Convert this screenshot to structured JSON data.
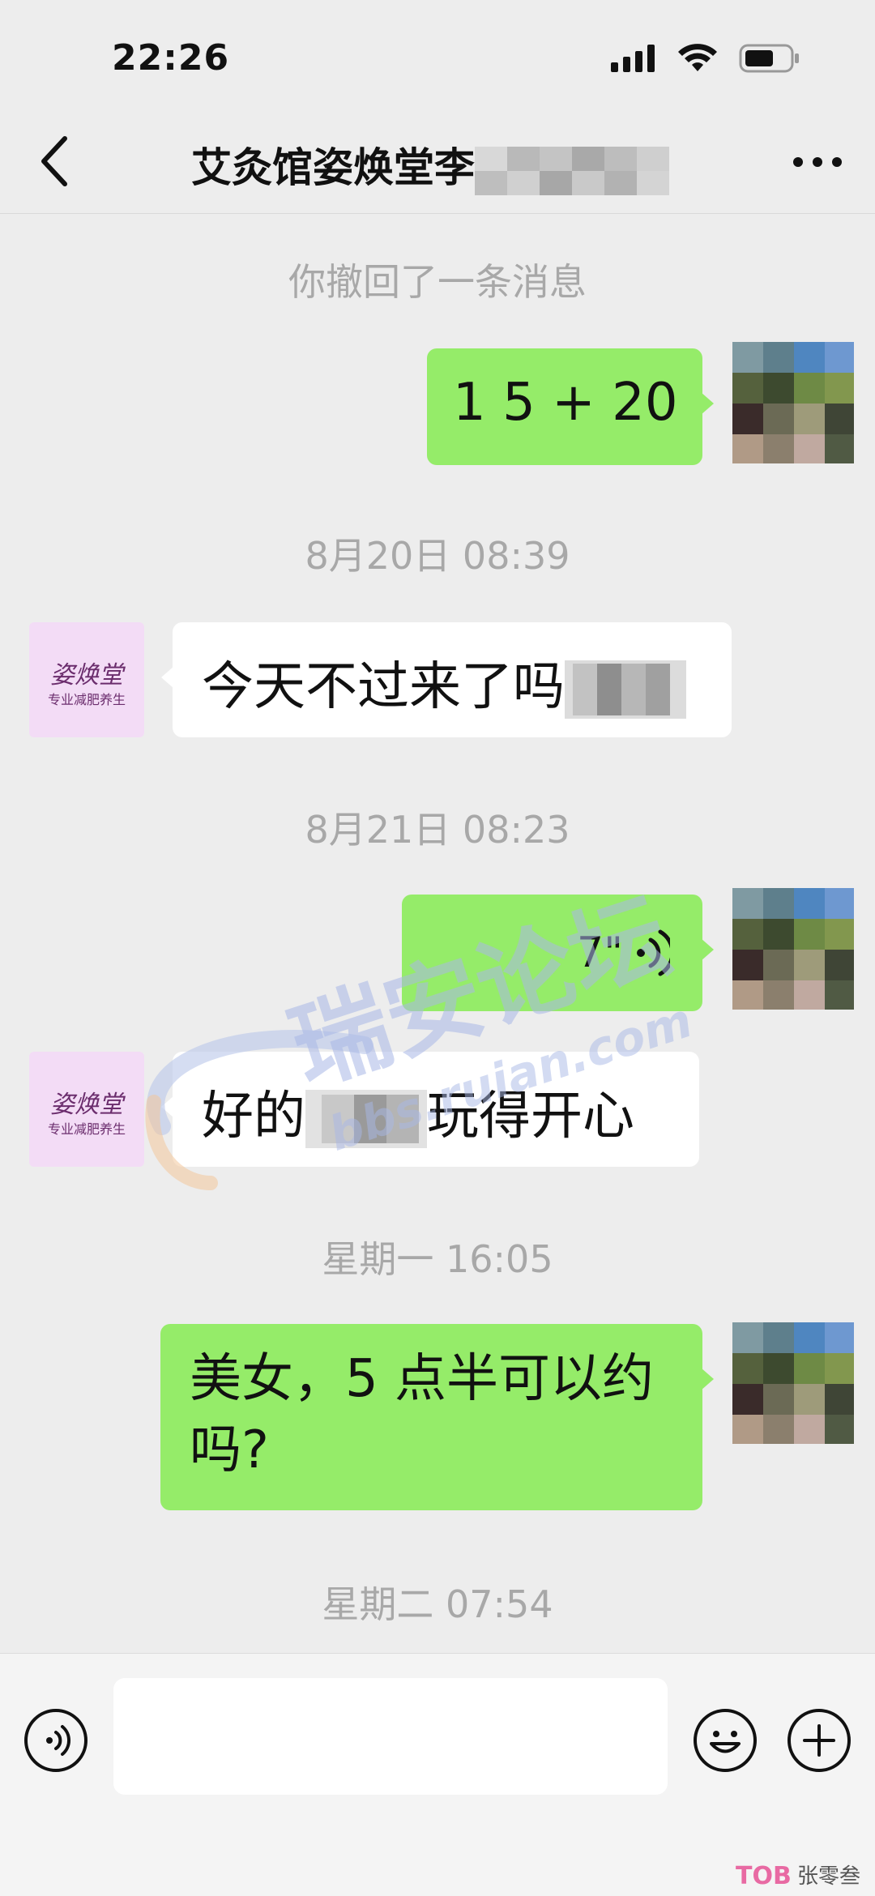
{
  "status_bar": {
    "time": "22:26"
  },
  "header": {
    "title": "艾灸馆姿焕堂李"
  },
  "recall_notice": "你撤回了一条消息",
  "messages": [
    {
      "sender": "me",
      "text": "1 5 + 20"
    },
    {
      "timestamp": "8月20日 08:39"
    },
    {
      "sender": "shop",
      "text": "今天不过来了吗"
    },
    {
      "timestamp": "8月21日 08:23"
    },
    {
      "sender": "me",
      "voice_duration": "7\""
    },
    {
      "sender": "shop",
      "text_a": "好的",
      "text_b": "玩得开心"
    },
    {
      "timestamp": "星期一 16:05"
    },
    {
      "sender": "me",
      "text_line1": "美女，5 点半可以约",
      "text_line2": "吗?"
    },
    {
      "timestamp": "星期二 07:54"
    }
  ],
  "shop_avatar": {
    "logo": "姿焕堂",
    "subtitle": "专业减肥养生"
  },
  "watermark": {
    "main": "瑞安论坛",
    "url": "bbs.ruian.com"
  },
  "corner_badge": {
    "text": "张零叁"
  },
  "colors": {
    "bubble_me": "#95ec69",
    "bubble_other": "#ffffff",
    "background": "#ededed",
    "timestamp": "#a8a8a8"
  }
}
